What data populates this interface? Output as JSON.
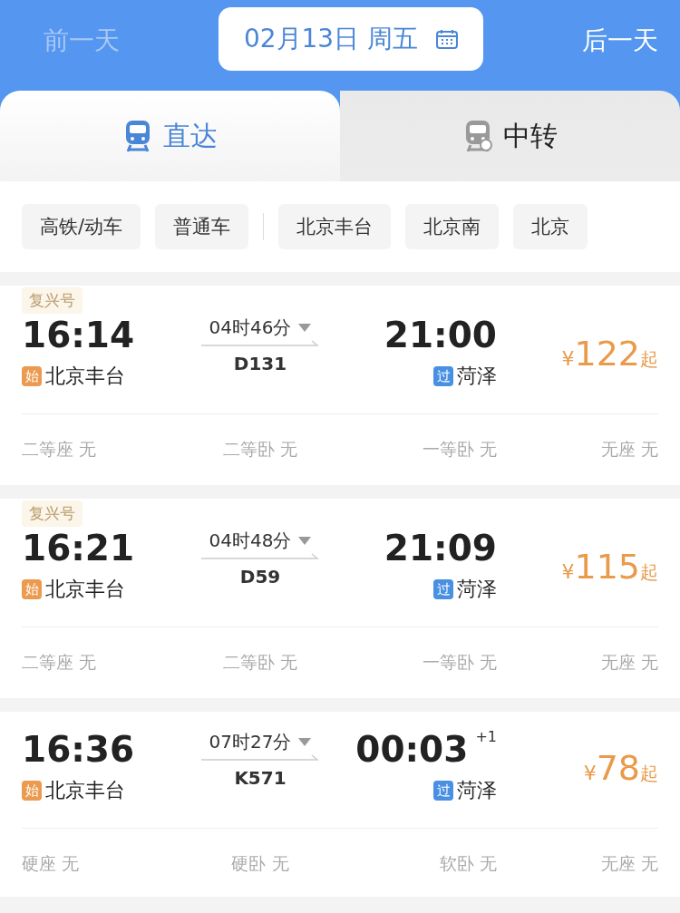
{
  "date_nav": {
    "prev": {
      "label": "前一天",
      "disabled": true
    },
    "date": "02月13日 周五",
    "next": {
      "label": "后一天",
      "disabled": false
    }
  },
  "tabs": [
    {
      "label": "直达",
      "selected": true
    },
    {
      "label": "中转",
      "selected": false
    }
  ],
  "filters": {
    "train_types": [
      "高铁/动车",
      "普通车"
    ],
    "stations": [
      "北京丰台",
      "北京南",
      "北京"
    ]
  },
  "trains": [
    {
      "badge": "复兴号",
      "depart_time": "16:14",
      "depart_tag": "始",
      "depart_station": "北京丰台",
      "duration": "04时46分",
      "number": "D131",
      "arrive_time": "21:00",
      "arrive_tag": "过",
      "arrive_station": "菏泽",
      "currency": "¥",
      "price": "122",
      "price_suffix": "起",
      "seats": [
        {
          "name": "二等座",
          "count": "无"
        },
        {
          "name": "二等卧",
          "count": "无"
        },
        {
          "name": "一等卧",
          "count": "无"
        },
        {
          "name": "无座",
          "count": "无"
        }
      ]
    },
    {
      "badge": "复兴号",
      "depart_time": "16:21",
      "depart_tag": "始",
      "depart_station": "北京丰台",
      "duration": "04时48分",
      "number": "D59",
      "arrive_time": "21:09",
      "arrive_tag": "过",
      "arrive_station": "菏泽",
      "currency": "¥",
      "price": "115",
      "price_suffix": "起",
      "seats": [
        {
          "name": "二等座",
          "count": "无"
        },
        {
          "name": "二等卧",
          "count": "无"
        },
        {
          "name": "一等卧",
          "count": "无"
        },
        {
          "name": "无座",
          "count": "无"
        }
      ]
    },
    {
      "depart_time": "16:36",
      "depart_tag": "始",
      "depart_station": "北京丰台",
      "duration": "07时27分",
      "number": "K571",
      "arrive_time": "00:03",
      "day_offset": "+1",
      "arrive_tag": "过",
      "arrive_station": "菏泽",
      "currency": "¥",
      "price": "78",
      "price_suffix": "起",
      "seats": [
        {
          "name": "硬座",
          "count": "无"
        },
        {
          "name": "硬卧",
          "count": "无"
        },
        {
          "name": "软卧",
          "count": "无"
        },
        {
          "name": "无座",
          "count": "无"
        }
      ]
    }
  ]
}
